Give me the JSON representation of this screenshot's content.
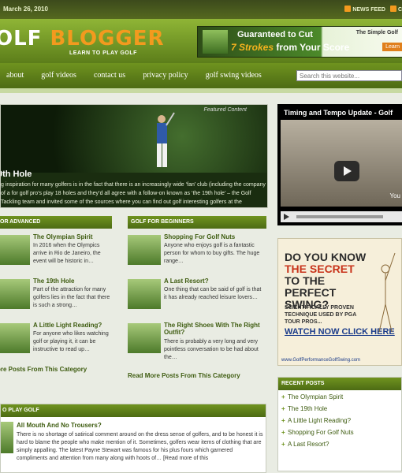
{
  "topbar": {
    "date": "March 26, 2010",
    "feeds": [
      "NEWS FEED",
      "C"
    ]
  },
  "header": {
    "logo_white": "OLF ",
    "logo_orange": "BLOGGER",
    "tagline": "LEARN TO PLAY GOLF",
    "banner": {
      "line1": "Guaranteed to Cut",
      "line2_em": "7 Strokes",
      "line2_rest": " from Your Score",
      "side": "The Simple Golf",
      "button": "Learn"
    }
  },
  "nav": {
    "items": [
      "about",
      "golf videos",
      "contact us",
      "privacy policy",
      "golf swing videos"
    ]
  },
  "search": {
    "placeholder": "Search this website..."
  },
  "featured": {
    "label": "Featured Content",
    "title": "9th Hole",
    "excerpt": "g inspiration for many golfers is in the fact that there is an increasingly wide ‘fan’ club (including the company of a for golf pro’s play 18 holes and they’d all agree with a follow-on known as ‘the 19th hole’ – the Golf Tackling team and invited some of the sources where you can find out golf interesting golfers at the"
  },
  "video": {
    "title": "Timing and Tempo Update - Golf",
    "yt": "You"
  },
  "columns": [
    {
      "header": "OR ADVANCED",
      "posts": [
        {
          "title": "The Olympian Spirit",
          "excerpt": "In 2016 when the Olympics arrive in Rio de Janeiro, the event will be historic in…"
        },
        {
          "title": "The 19th Hole",
          "excerpt": "Part of the attraction for many golfers lies in the fact that there is such a strong…"
        },
        {
          "title": "A Little Light Reading?",
          "excerpt": "For anyone who likes watching golf or playing it, it can be instructive to read up…"
        }
      ],
      "more": "ore Posts From This Category"
    },
    {
      "header": "GOLF FOR BEGINNERS",
      "posts": [
        {
          "title": "Shopping For Golf Nuts",
          "excerpt": "Anyone who enjoys golf is a fantastic person for whom to buy gifts. The huge range…"
        },
        {
          "title": "A Last Resort?",
          "excerpt": "One thing that can be said of golf is that it has already reached leisure lovers…"
        },
        {
          "title": "The Right Shoes With The Right Outfit?",
          "excerpt": "There is probably a very long and very pointless conversation to be had about the…"
        }
      ],
      "more": "Read More Posts From This Category"
    }
  ],
  "ad": {
    "line1_pre": "DO YOU KNOW ",
    "line1_em": "THE SECRET",
    "line1_post": " TO THE PERFECT SWING?",
    "sub": "SCIENTIFICALLY PROVEN TECHNIQUE USED BY PGA TOUR PROS...",
    "cta": "WATCH NOW CLICK HERE",
    "url": "www.GolfPerformanceGolfSwing.com"
  },
  "recent": {
    "header": "RECENT POSTS",
    "items": [
      "The Olympian Spirit",
      "The 19th Hole",
      "A Little Light Reading?",
      "Shopping For Golf Nuts",
      "A Last Resort?"
    ]
  },
  "bottom": {
    "header": "O PLAY GOLF",
    "title": "All Mouth And No Trousers?",
    "excerpt": "There is no shortage of satirical comment around on the dress sense of golfers, and to be honest it is hard to blame the people who make mention of it. Sometimes, golfers wear items of clothing that are simply appalling. The latest Payne Stewart was famous for his plus fours which garnered compliments and attention from many along with hoots of… [Read more of this"
  }
}
